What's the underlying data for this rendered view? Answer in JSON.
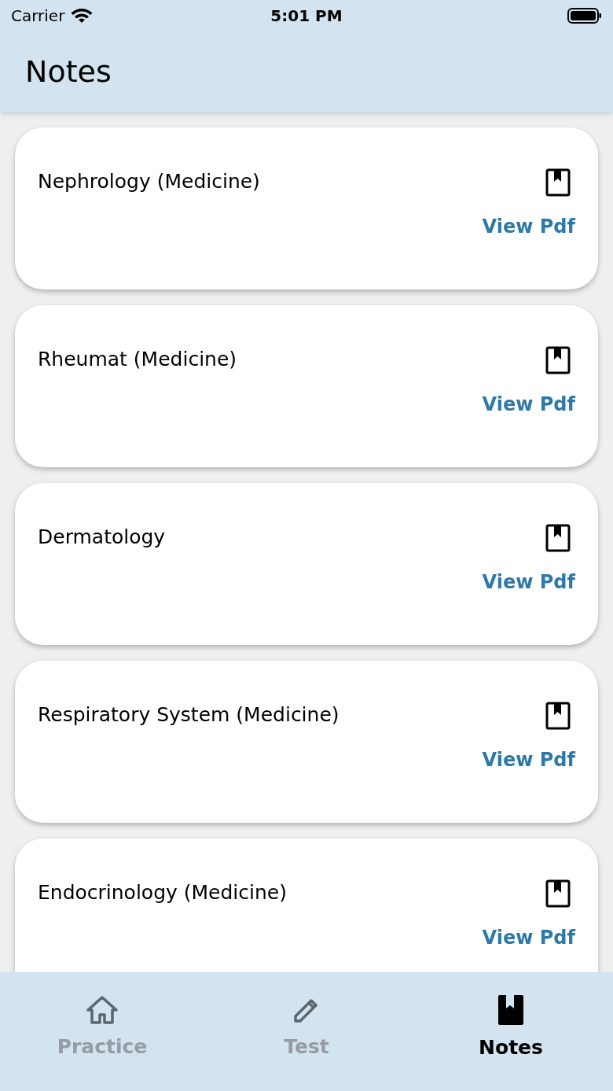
{
  "status_bar": {
    "carrier": "Carrier",
    "time": "5:01 PM"
  },
  "header": {
    "title": "Notes"
  },
  "notes": [
    {
      "title": "Nephrology (Medicine)",
      "action": "View Pdf"
    },
    {
      "title": "Rheumat (Medicine)",
      "action": "View Pdf"
    },
    {
      "title": "Dermatology",
      "action": "View Pdf"
    },
    {
      "title": "Respiratory System (Medicine)",
      "action": "View Pdf"
    },
    {
      "title": "Endocrinology (Medicine)",
      "action": "View Pdf"
    }
  ],
  "tabs": [
    {
      "label": "Practice",
      "kind": "home",
      "selected": false
    },
    {
      "label": "Test",
      "kind": "pencil",
      "selected": false
    },
    {
      "label": "Notes",
      "kind": "book",
      "selected": true
    }
  ]
}
